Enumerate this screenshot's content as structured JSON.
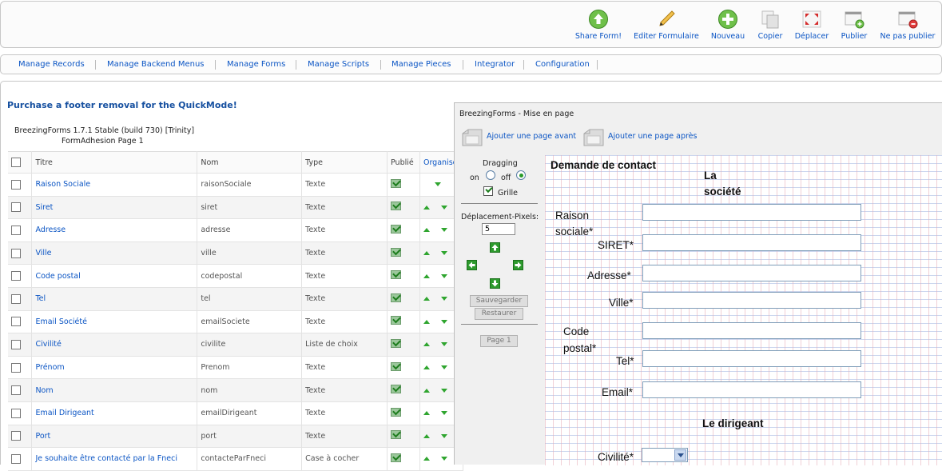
{
  "toolbar": {
    "share": "Share Form!",
    "edit": "Editer Formulaire",
    "new": "Nouveau",
    "copy": "Copier",
    "move": "Déplacer",
    "publish": "Publier",
    "unpublish": "Ne pas publier"
  },
  "submenu": [
    "Manage Records",
    "Manage Backend Menus",
    "Manage Forms",
    "Manage Scripts",
    "Manage Pieces",
    "Integrator",
    "Configuration"
  ],
  "promo": "Purchase a footer removal for the QuickMode!",
  "version": "BreezingForms 1.7.1 Stable (build 730) [Trinity]",
  "form_page": "FormAdhesion Page 1",
  "table": {
    "headers": {
      "title": "Titre",
      "name": "Nom",
      "type": "Type",
      "published": "Publié",
      "order": "Organise"
    },
    "rows": [
      {
        "title": "Raison Sociale",
        "name": "raisonSociale",
        "type": "Texte"
      },
      {
        "title": "Siret",
        "name": "siret",
        "type": "Texte"
      },
      {
        "title": "Adresse",
        "name": "adresse",
        "type": "Texte"
      },
      {
        "title": "Ville",
        "name": "ville",
        "type": "Texte"
      },
      {
        "title": "Code postal",
        "name": "codepostal",
        "type": "Texte"
      },
      {
        "title": "Tel",
        "name": "tel",
        "type": "Texte"
      },
      {
        "title": "Email Société",
        "name": "emailSociete",
        "type": "Texte"
      },
      {
        "title": "Civilité",
        "name": "civilite",
        "type": "Liste de choix"
      },
      {
        "title": "Prénom",
        "name": "Prenom",
        "type": "Texte"
      },
      {
        "title": "Nom",
        "name": "nom",
        "type": "Texte"
      },
      {
        "title": "Email Dirigeant",
        "name": "emailDirigeant",
        "type": "Texte"
      },
      {
        "title": "Port",
        "name": "port",
        "type": "Texte"
      },
      {
        "title": "Je souhaite être contacté par la Fneci",
        "name": "contacteParFneci",
        "type": "Case à cocher"
      }
    ]
  },
  "panel": {
    "title": "BreezingForms - Mise en page",
    "add_before": "Ajouter une page avant",
    "add_after": "Ajouter une page après",
    "dragging": "Dragging",
    "on": "on",
    "off": "off",
    "grid": "Grille",
    "pixels_label": "Déplacement-Pixels:",
    "pixels_value": "5",
    "save": "Sauvegarder",
    "restore": "Restaurer",
    "page": "Page 1"
  },
  "canvas": {
    "heading": "Demande de contact",
    "section1_line1": "La",
    "section1_line2": "société",
    "raison_line1": "Raison",
    "raison_line2": "sociale*",
    "siret": "SIRET*",
    "adresse": "Adresse*",
    "ville": "Ville*",
    "cp_line1": "Code",
    "cp_line2": "postal*",
    "tel": "Tel*",
    "email": "Email*",
    "section2": "Le dirigeant",
    "civilite": "Civilité*"
  }
}
